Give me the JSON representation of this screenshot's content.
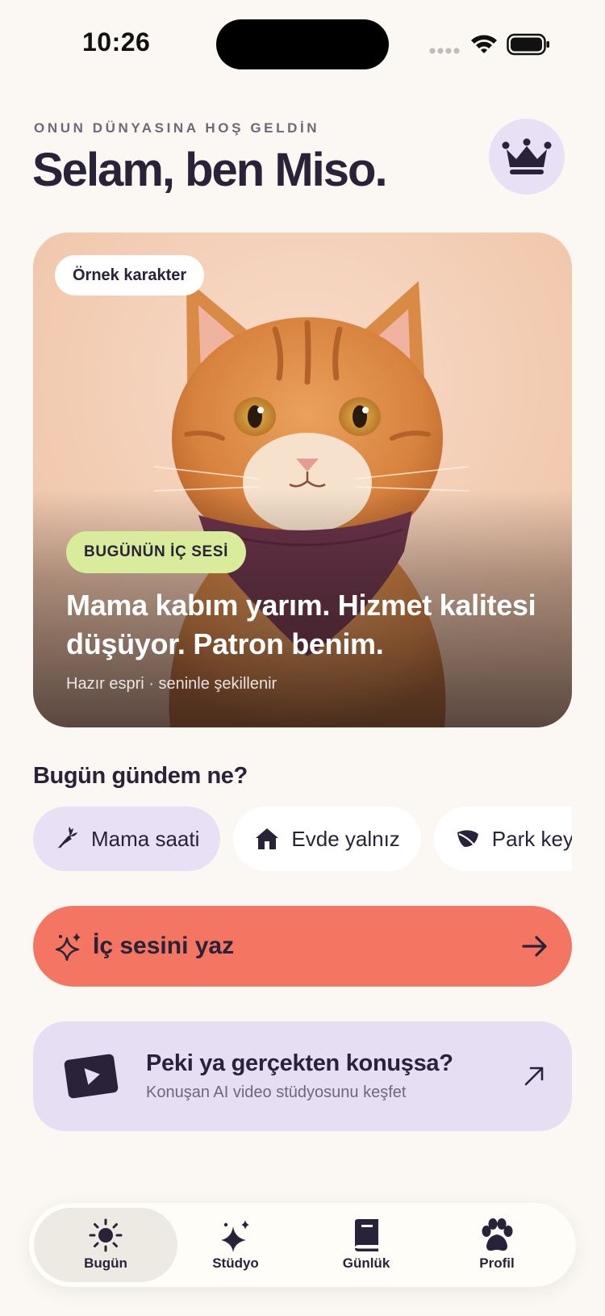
{
  "status_bar": {
    "time": "10:26"
  },
  "header": {
    "eyebrow": "ONUN DÜNYASINA HOŞ GELDİN",
    "title": "Selam, ben Miso.",
    "premium_icon": "crown-icon"
  },
  "hero": {
    "badge": "Örnek karakter",
    "tag": "BUGÜNÜN İÇ SESİ",
    "quote": "Mama kabım yarım. Hizmet kalitesi düşüyor. Patron benim.",
    "caption": "Hazır espri · seninle şekillenir",
    "image": "orange-tabby-cat-with-purple-bandana"
  },
  "topics": {
    "title": "Bugün gündem ne?",
    "chips": [
      {
        "label": "Mama saati",
        "icon": "carrot-icon",
        "active": true
      },
      {
        "label": "Evde yalnız",
        "icon": "home-icon",
        "active": false
      },
      {
        "label": "Park keyfi",
        "icon": "leaf-icon",
        "active": false
      }
    ]
  },
  "cta": {
    "label": "İç sesini yaz",
    "icon": "sparkle-icon",
    "arrow_icon": "arrow-right-icon"
  },
  "promo": {
    "title": "Peki ya gerçekten konuşsa?",
    "subtitle": "Konuşan AI video stüdyosunu keşfet",
    "icon": "video-play-icon",
    "arrow_icon": "arrow-up-right-icon"
  },
  "tabs": [
    {
      "label": "Bugün",
      "icon": "sun-icon",
      "active": true
    },
    {
      "label": "Stüdyo",
      "icon": "sparkles-icon",
      "active": false
    },
    {
      "label": "Günlük",
      "icon": "book-icon",
      "active": false
    },
    {
      "label": "Profil",
      "icon": "paw-icon",
      "active": false
    }
  ],
  "colors": {
    "background": "#FBF8F3",
    "ink": "#2A2238",
    "lavender": "#E8E0F4",
    "coral": "#F37562",
    "lime": "#D9EC9B"
  }
}
